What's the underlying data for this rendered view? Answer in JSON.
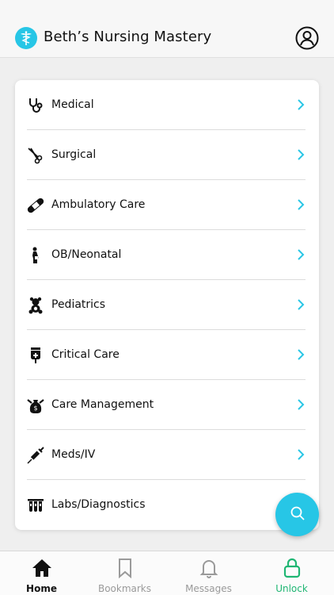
{
  "header": {
    "title": "Beth’s Nursing Mastery",
    "logo_icon": "caduceus-icon",
    "profile_icon": "user-circle-icon",
    "accent": "#27c6e6"
  },
  "categories": [
    {
      "label": "Medical",
      "icon": "stethoscope-icon"
    },
    {
      "label": "Surgical",
      "icon": "scissors-icon"
    },
    {
      "label": "Ambulatory Care",
      "icon": "bandage-icon"
    },
    {
      "label": "OB/Neonatal",
      "icon": "pregnant-woman-icon"
    },
    {
      "label": "Pediatrics",
      "icon": "teddy-bear-icon"
    },
    {
      "label": "Critical Care",
      "icon": "iv-bag-icon"
    },
    {
      "label": "Care Management",
      "icon": "money-bag-icon"
    },
    {
      "label": "Meds/IV",
      "icon": "syringe-icon"
    },
    {
      "label": "Labs/Diagnostics",
      "icon": "test-tubes-icon"
    }
  ],
  "fab": {
    "icon": "search-icon"
  },
  "tabs": [
    {
      "label": "Home",
      "icon": "home-icon",
      "active": true
    },
    {
      "label": "Bookmarks",
      "icon": "bookmark-icon"
    },
    {
      "label": "Messages",
      "icon": "bell-icon"
    },
    {
      "label": "Unlock",
      "icon": "lock-icon",
      "color": "#1fb673"
    }
  ]
}
